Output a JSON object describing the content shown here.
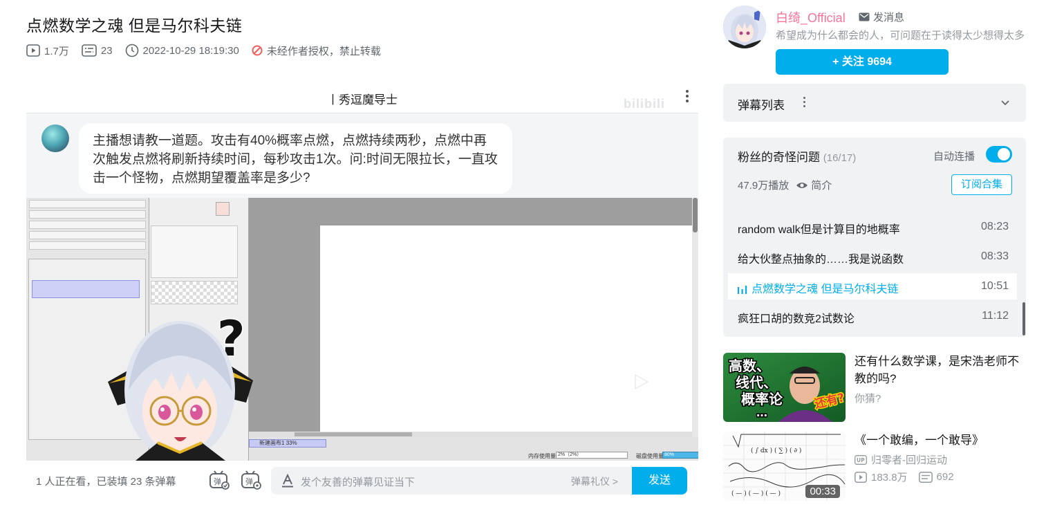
{
  "video": {
    "title": "点燃数学之魂 但是马尔科夫链",
    "views": "1.7万",
    "danmaku_count": "23",
    "pubdate": "2022-10-29 18:19:30",
    "copyright": "未经作者授权，禁止转载"
  },
  "player": {
    "streamer_title": "丨秀逗魔导士",
    "watermark": "bilibili",
    "question": "主播想请教一道题。攻击有40%概率点燃，点燃持续两秒，点燃中再次触发点燃将刷新持续时间，每秒攻击1次。问:时间无限拉长，一直攻击一个怪物，点燃期望覆盖率是多少?",
    "paint_tab": "新建画布1",
    "paint_tab_zoom": "33%",
    "mem_label": "内存使用量",
    "mem_value": "2%（2%）",
    "disk_label": "磁盘使用量",
    "disk_value": "80%",
    "watching_text": "1 人正在看，已装填 23 条弹幕",
    "danmaku_placeholder": "发个友善的弹幕见证当下",
    "etiquette": "弹幕礼仪 >",
    "send": "发送"
  },
  "uploader": {
    "name": "白绮_Official",
    "message": "发消息",
    "desc": "希望成为什么都会的人，可问题在于读得太少想得太多",
    "follow": "+ 关注 9694"
  },
  "danmaku_list": {
    "label": "弹幕列表"
  },
  "collection": {
    "title": "粉丝的奇怪问题",
    "count": "(16/17)",
    "autoplay": "自动连播",
    "plays": "47.9万播放",
    "intro": "简介",
    "subscribe": "订阅合集",
    "episodes": [
      {
        "title": "random walk但是计算目的地概率",
        "time": "08:23"
      },
      {
        "title": "给大伙整点抽象的……我是说函数",
        "time": "08:33"
      },
      {
        "title": "点燃数学之魂 但是马尔科夫链",
        "time": "10:51"
      },
      {
        "title": "疯狂口胡的数竞2试数论",
        "time": "11:12"
      }
    ]
  },
  "recommendations": [
    {
      "title": "还有什么数学课，是宋浩老师不教的吗?",
      "sub": "你猜?",
      "thumb_text_1": "高数、",
      "thumb_text_2": "线代、",
      "thumb_text_3": "概率论",
      "thumb_text_4": "…",
      "thumb_text_5": "还有?"
    },
    {
      "title": "《一个敢编，一个敢导》",
      "author": "归零者-回归运动",
      "views": "183.8万",
      "danmaku": "692",
      "duration": "00:33"
    }
  ],
  "colors": {
    "accent": "#00aeec",
    "uploader_name": "#fb7299",
    "panel_bg": "#f1f2f3"
  }
}
